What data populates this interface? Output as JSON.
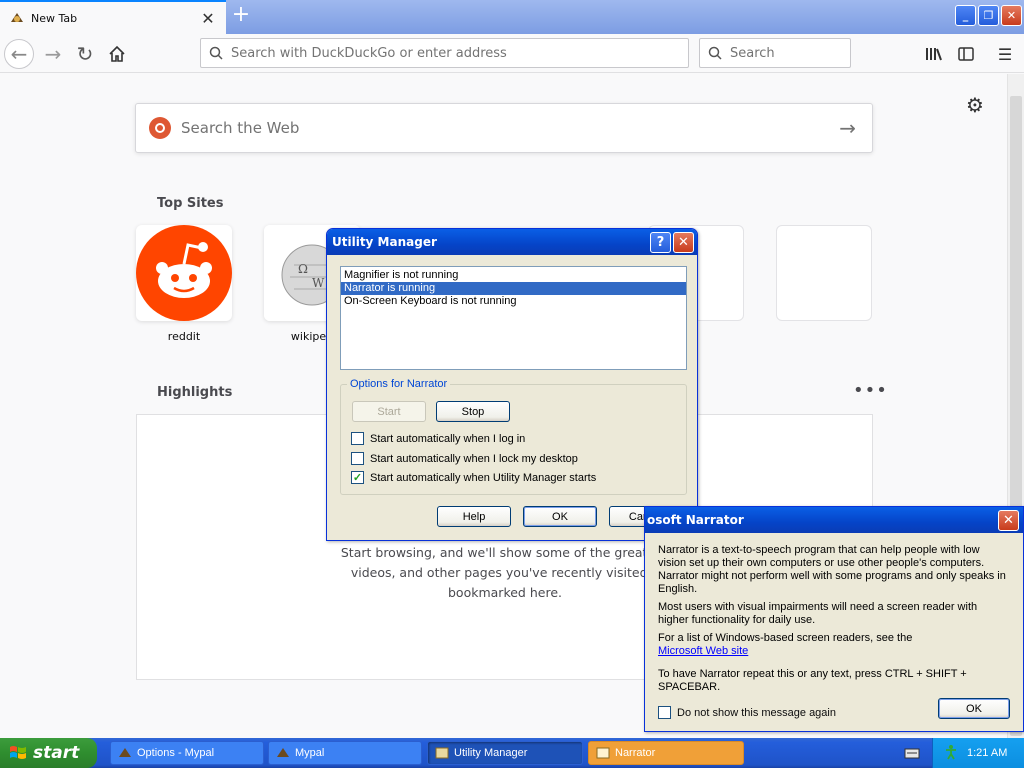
{
  "browser": {
    "tab_title": "New Tab",
    "tab_close": "✕",
    "new_tab": "+",
    "url_placeholder": "Search with DuckDuckGo or enter address",
    "search_placeholder": "Search"
  },
  "newtab": {
    "web_search_placeholder": "Search the Web",
    "top_sites_title": "Top Sites",
    "top_sites": [
      {
        "label": "reddit"
      },
      {
        "label": "wikiped"
      }
    ],
    "highlights_title": "Highlights",
    "highlights_empty_line1": "Start browsing, and we'll show some of the great art",
    "highlights_empty_line2": "videos, and other pages you've recently visited o",
    "highlights_empty_line3": "bookmarked here."
  },
  "utility_manager": {
    "title": "Utility Manager",
    "help_glyph": "?",
    "close_glyph": "✕",
    "list": [
      {
        "label": "Magnifier is not running",
        "selected": false
      },
      {
        "label": "Narrator is running",
        "selected": true
      },
      {
        "label": "On-Screen Keyboard is not running",
        "selected": false
      }
    ],
    "options_label": "Options for Narrator",
    "start_button": "Start",
    "stop_button": "Stop",
    "checkboxes": [
      {
        "label": "Start automatically when I log in",
        "checked": false
      },
      {
        "label": "Start automatically when I lock my desktop",
        "checked": false
      },
      {
        "label": "Start automatically when Utility Manager starts",
        "checked": true
      }
    ],
    "help_button": "Help",
    "ok_button": "OK",
    "cancel_button": "Cancel"
  },
  "narrator": {
    "title": "osoft Narrator",
    "close_glyph": "✕",
    "para1": "Narrator is a text-to-speech program that can help people with low vision set up their own computers or use other people's computers. Narrator might not perform well with some programs and only speaks in English.",
    "para2": "Most users with visual impairments will need a screen reader with higher functionality for daily use.",
    "para3": "For a list of Windows-based screen readers, see the",
    "link": "Microsoft Web site",
    "para4": "To have Narrator repeat this or any text, press CTRL + SHIFT + SPACEBAR.",
    "checkbox_label": "Do not show this message again",
    "ok_button": "OK"
  },
  "taskbar": {
    "start_label": "start",
    "tasks": [
      {
        "label": "Options - Mypal"
      },
      {
        "label": "Mypal"
      },
      {
        "label": "Utility Manager"
      },
      {
        "label": "Narrator"
      }
    ],
    "clock": "1:21 AM"
  },
  "colors": {
    "xp_title": "#0544c8",
    "selection": "#316ac5",
    "reddit": "#ff4500",
    "start_green": "#2f8e2f"
  }
}
